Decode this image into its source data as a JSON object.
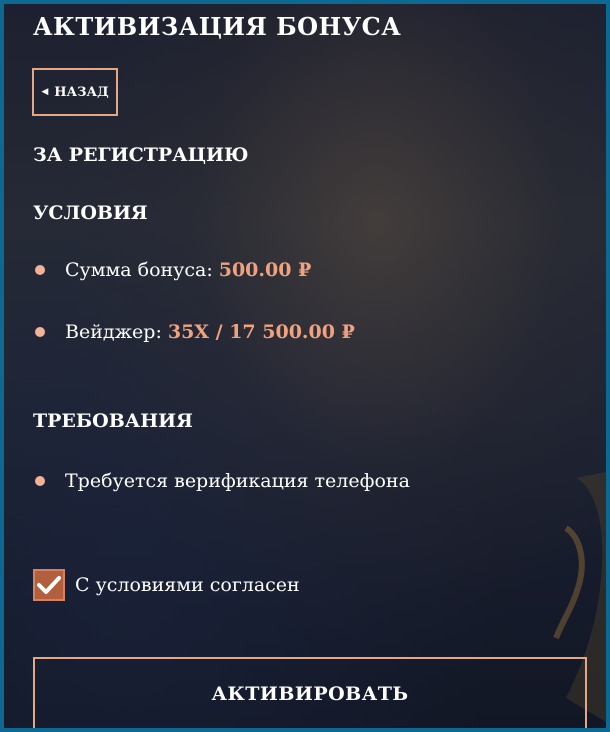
{
  "header": {
    "title": "АКТИВИЗАЦИЯ БОНУСА",
    "back_label": "НАЗАД"
  },
  "bonus": {
    "type_label": "ЗА РЕГИСТРАЦИЮ"
  },
  "conditions": {
    "heading": "УСЛОВИЯ",
    "items": [
      {
        "label": "Сумма бонуса:",
        "value": "500.00 ₽"
      },
      {
        "label": "Вейджер:",
        "value": "35X / 17 500.00 ₽"
      }
    ]
  },
  "requirements": {
    "heading": "ТРЕБОВАНИЯ",
    "items": [
      {
        "label": "Требуется верификация телефона"
      }
    ]
  },
  "agreement": {
    "label": "С условиями согласен",
    "checked": true
  },
  "actions": {
    "activate_label": "АКТИВИРОВАТЬ"
  },
  "icons": {
    "back": "chevron-left-icon",
    "check": "checkmark-icon",
    "bullet": "bullet-dot-icon"
  },
  "colors": {
    "accent": "#f0a27e",
    "border": "#e5a885",
    "checkbox_fill": "#b25f3e",
    "frame": "#0c6a92",
    "background": "#1f2433"
  }
}
